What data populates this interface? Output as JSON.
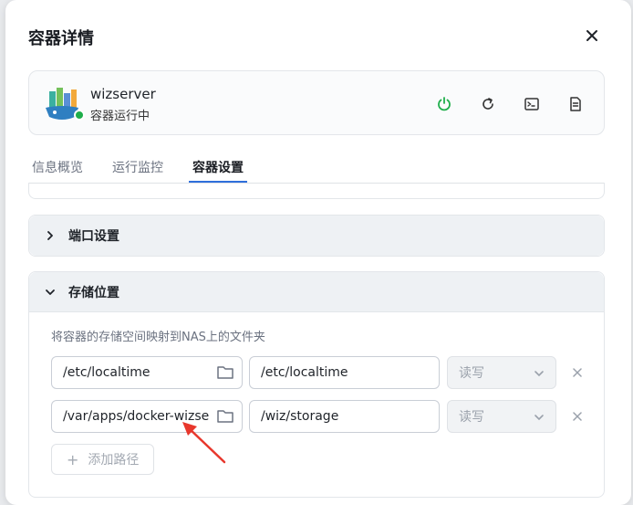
{
  "dialog": {
    "title": "容器详情"
  },
  "app": {
    "name": "wizserver",
    "status": "容器运行中",
    "status_color": "#1fae4b",
    "actions": [
      "power-icon",
      "restart-icon",
      "terminal-icon",
      "log-icon"
    ]
  },
  "tabs": [
    {
      "label": "信息概览"
    },
    {
      "label": "运行监控"
    },
    {
      "label": "容器设置"
    }
  ],
  "active_tab": "容器设置",
  "sections": {
    "port": {
      "label": "端口设置",
      "expanded": false
    },
    "storage": {
      "label": "存储位置",
      "expanded": true,
      "hint": "将容器的存储空间映射到NAS上的文件夹",
      "rows": [
        {
          "host_path": "/etc/localtime",
          "container_path": "/etc/localtime",
          "mode": "读写"
        },
        {
          "host_path": "/var/apps/docker-wizserver",
          "container_path": "/wiz/storage",
          "mode": "读写"
        }
      ],
      "add_label": "添加路径"
    }
  },
  "colors": {
    "accent": "#2f6fdb",
    "power": "#1fae4b",
    "annotation_arrow": "#e8372c"
  }
}
